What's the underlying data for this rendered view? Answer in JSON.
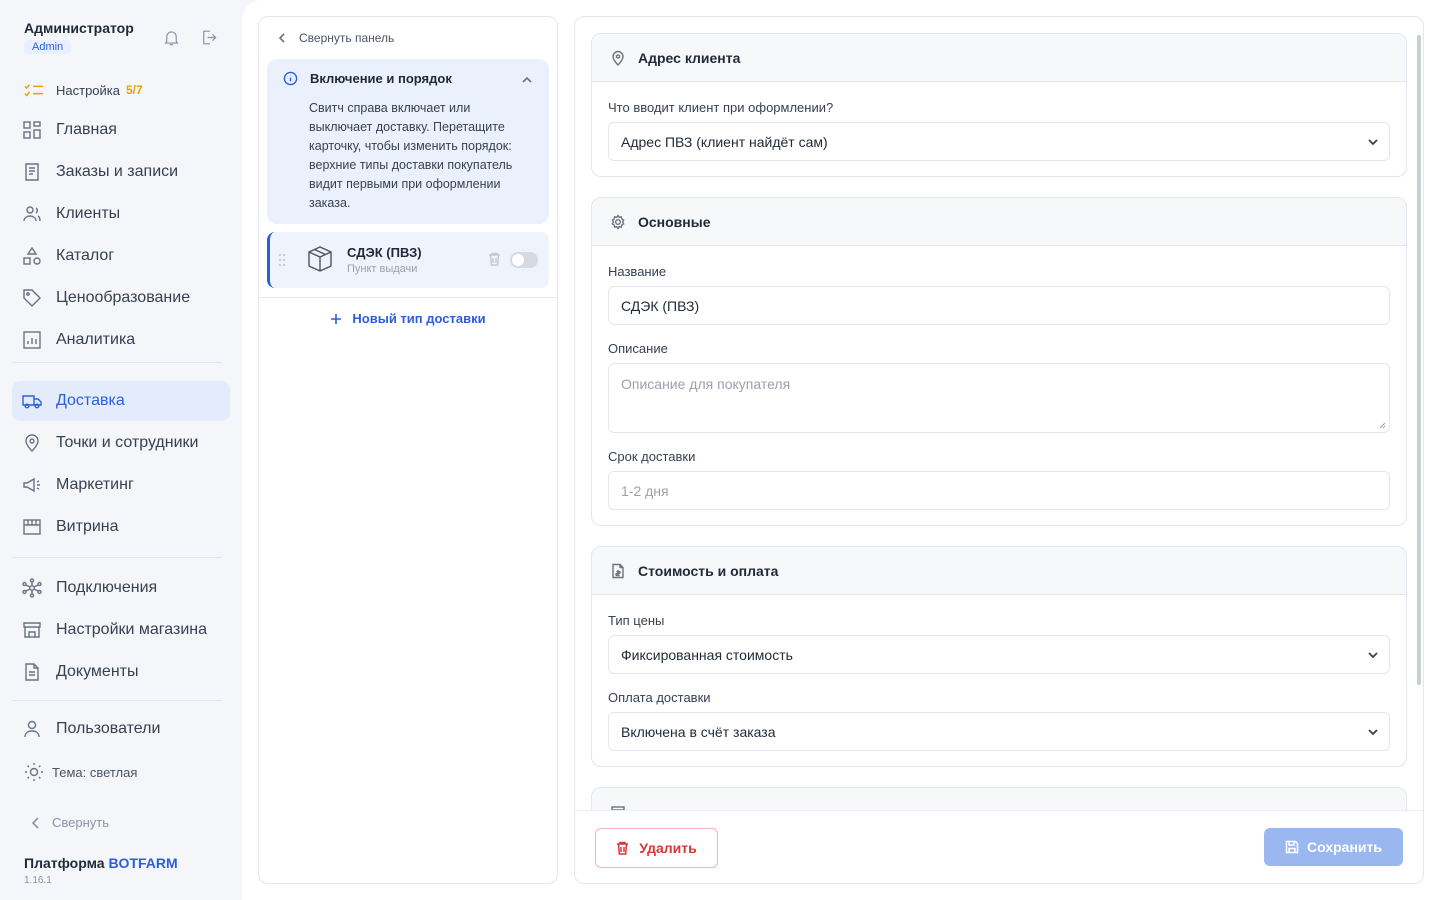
{
  "user": {
    "name": "Администратор",
    "role": "Admin"
  },
  "setup": {
    "label": "Настройка",
    "progress": "5/7"
  },
  "nav": {
    "group1": [
      {
        "label": "Главная",
        "icon": "grid-icon"
      },
      {
        "label": "Заказы и записи",
        "icon": "orders-icon"
      },
      {
        "label": "Клиенты",
        "icon": "users-icon"
      },
      {
        "label": "Каталог",
        "icon": "catalog-icon"
      },
      {
        "label": "Ценообразование",
        "icon": "tag-icon"
      },
      {
        "label": "Аналитика",
        "icon": "analytics-icon"
      }
    ],
    "group2": [
      {
        "label": "Доставка",
        "icon": "truck-icon",
        "active": true
      },
      {
        "label": "Точки и сотрудники",
        "icon": "map-pin-icon"
      },
      {
        "label": "Маркетинг",
        "icon": "megaphone-icon"
      },
      {
        "label": "Витрина",
        "icon": "storefront-icon"
      }
    ],
    "group3": [
      {
        "label": "Подключения",
        "icon": "network-icon"
      },
      {
        "label": "Настройки магазина",
        "icon": "store-icon"
      },
      {
        "label": "Документы",
        "icon": "document-icon"
      }
    ],
    "group4": [
      {
        "label": "Пользователи",
        "icon": "user-icon"
      }
    ]
  },
  "theme_label": "Тема: светлая",
  "collapse_sidebar_label": "Свернуть",
  "platform": {
    "prefix": "Платформа",
    "brand": "BOTFARM",
    "version": "1.16.1"
  },
  "list_panel": {
    "collapse_label": "Свернуть панель",
    "info_title": "Включение и порядок",
    "info_text": "Свитч справа включает или выключает доставку. Перетащите карточку, чтобы изменить порядок: верхние типы доставки покупатель видит первыми при оформлении заказа.",
    "delivery": {
      "title": "СДЭК (ПВЗ)",
      "subtitle": "Пункт выдачи",
      "enabled": false
    },
    "new_type_label": "Новый тип доставки"
  },
  "form": {
    "address": {
      "title": "Адрес клиента",
      "question_label": "Что вводит клиент при оформлении?",
      "question_value": "Адрес ПВЗ (клиент найдёт сам)"
    },
    "basic": {
      "title": "Основные",
      "name_label": "Название",
      "name_value": "СДЭК (ПВЗ)",
      "desc_label": "Описание",
      "desc_placeholder": "Описание для покупателя",
      "term_label": "Срок доставки",
      "term_placeholder": "1-2 дня"
    },
    "cost": {
      "title": "Стоимость и оплата",
      "price_type_label": "Тип цены",
      "price_type_value": "Фиксированная стоимость",
      "payment_label": "Оплата доставки",
      "payment_value": "Включена в счёт заказа"
    },
    "delete_label": "Удалить",
    "save_label": "Сохранить"
  },
  "colors": {
    "accent": "#2b5fd9",
    "danger": "#d93636",
    "warning": "#e5a400"
  }
}
